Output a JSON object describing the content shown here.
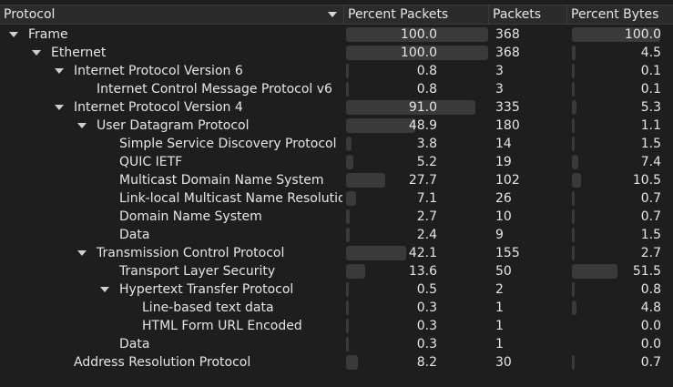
{
  "columns": {
    "protocol": "Protocol",
    "percent_packets": "Percent Packets",
    "packets": "Packets",
    "percent_bytes": "Percent Bytes"
  },
  "rows": [
    {
      "name": "Frame",
      "depth": 0,
      "expand": true,
      "pp": "100.0",
      "pp_v": 100.0,
      "pk": "368",
      "pb": "100.0",
      "pb_v": 100.0
    },
    {
      "name": "Ethernet",
      "depth": 1,
      "expand": true,
      "pp": "100.0",
      "pp_v": 100.0,
      "pk": "368",
      "pb": "4.5",
      "pb_v": 4.5
    },
    {
      "name": "Internet Protocol Version 6",
      "depth": 2,
      "expand": true,
      "pp": "0.8",
      "pp_v": 0.8,
      "pk": "3",
      "pb": "0.1",
      "pb_v": 0.1
    },
    {
      "name": "Internet Control Message Protocol v6",
      "depth": 3,
      "expand": false,
      "pp": "0.8",
      "pp_v": 0.8,
      "pk": "3",
      "pb": "0.1",
      "pb_v": 0.1
    },
    {
      "name": "Internet Protocol Version 4",
      "depth": 2,
      "expand": true,
      "pp": "91.0",
      "pp_v": 91.0,
      "pk": "335",
      "pb": "5.3",
      "pb_v": 5.3
    },
    {
      "name": "User Datagram Protocol",
      "depth": 3,
      "expand": true,
      "pp": "48.9",
      "pp_v": 48.9,
      "pk": "180",
      "pb": "1.1",
      "pb_v": 1.1
    },
    {
      "name": "Simple Service Discovery Protocol",
      "depth": 4,
      "expand": false,
      "pp": "3.8",
      "pp_v": 3.8,
      "pk": "14",
      "pb": "1.5",
      "pb_v": 1.5
    },
    {
      "name": "QUIC IETF",
      "depth": 4,
      "expand": false,
      "pp": "5.2",
      "pp_v": 5.2,
      "pk": "19",
      "pb": "7.4",
      "pb_v": 7.4
    },
    {
      "name": "Multicast Domain Name System",
      "depth": 4,
      "expand": false,
      "pp": "27.7",
      "pp_v": 27.7,
      "pk": "102",
      "pb": "10.5",
      "pb_v": 10.5
    },
    {
      "name": "Link-local Multicast Name Resolution",
      "depth": 4,
      "expand": false,
      "pp": "7.1",
      "pp_v": 7.1,
      "pk": "26",
      "pb": "0.7",
      "pb_v": 0.7
    },
    {
      "name": "Domain Name System",
      "depth": 4,
      "expand": false,
      "pp": "2.7",
      "pp_v": 2.7,
      "pk": "10",
      "pb": "0.7",
      "pb_v": 0.7
    },
    {
      "name": "Data",
      "depth": 4,
      "expand": false,
      "pp": "2.4",
      "pp_v": 2.4,
      "pk": "9",
      "pb": "1.5",
      "pb_v": 1.5
    },
    {
      "name": "Transmission Control Protocol",
      "depth": 3,
      "expand": true,
      "pp": "42.1",
      "pp_v": 42.1,
      "pk": "155",
      "pb": "2.7",
      "pb_v": 2.7
    },
    {
      "name": "Transport Layer Security",
      "depth": 4,
      "expand": false,
      "pp": "13.6",
      "pp_v": 13.6,
      "pk": "50",
      "pb": "51.5",
      "pb_v": 51.5
    },
    {
      "name": "Hypertext Transfer Protocol",
      "depth": 4,
      "expand": true,
      "pp": "0.5",
      "pp_v": 0.5,
      "pk": "2",
      "pb": "0.8",
      "pb_v": 0.8
    },
    {
      "name": "Line-based text data",
      "depth": 5,
      "expand": false,
      "pp": "0.3",
      "pp_v": 0.3,
      "pk": "1",
      "pb": "4.8",
      "pb_v": 4.8
    },
    {
      "name": "HTML Form URL Encoded",
      "depth": 5,
      "expand": false,
      "pp": "0.3",
      "pp_v": 0.3,
      "pk": "1",
      "pb": "0.0",
      "pb_v": 0.0
    },
    {
      "name": "Data",
      "depth": 4,
      "expand": false,
      "pp": "0.3",
      "pp_v": 0.3,
      "pk": "1",
      "pb": "0.0",
      "pb_v": 0.0
    },
    {
      "name": "Address Resolution Protocol",
      "depth": 2,
      "expand": false,
      "pp": "8.2",
      "pp_v": 8.2,
      "pk": "30",
      "pb": "0.7",
      "pb_v": 0.7
    }
  ]
}
